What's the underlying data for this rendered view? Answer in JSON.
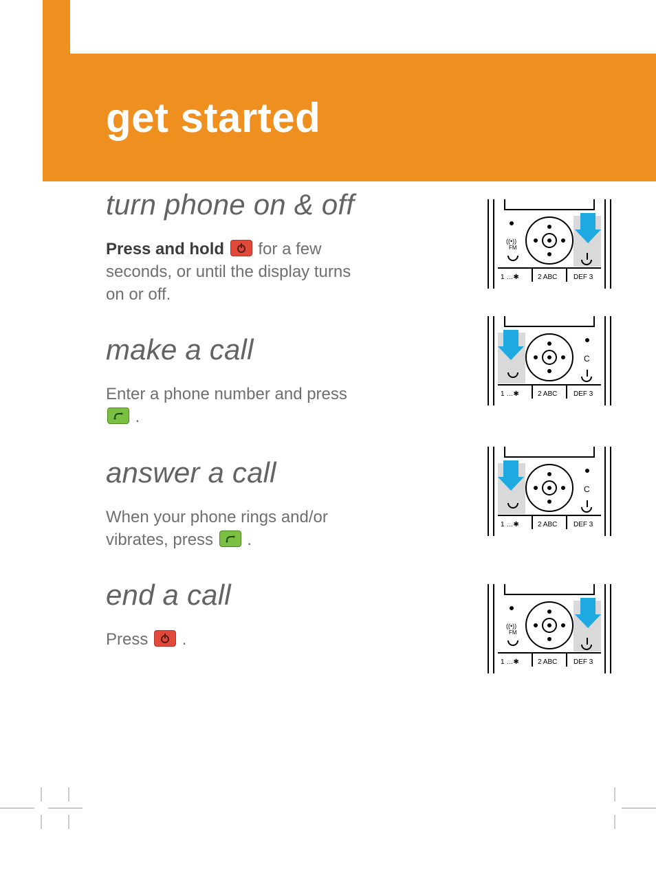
{
  "banner": {
    "title": "get started"
  },
  "sections": {
    "s1": {
      "heading": "turn phone on & off",
      "lead": "Press and hold ",
      "tail": " for a few seconds, or until the display turns on or off.",
      "key": "red"
    },
    "s2": {
      "heading": "make a call",
      "lead": "Enter a phone number and press ",
      "tail": ".",
      "key": "green"
    },
    "s3": {
      "heading": "answer a call",
      "lead": "When your phone rings and/or vibrates, press ",
      "tail": ".",
      "key": "green"
    },
    "s4": {
      "heading": "end a call",
      "lead": "Press ",
      "tail": ".",
      "key": "red"
    }
  },
  "keypad": {
    "k1": "1 …✱",
    "k2": "2 ABC",
    "k3": "DEF 3",
    "fm": "((•))\nFM",
    "c": "C"
  }
}
